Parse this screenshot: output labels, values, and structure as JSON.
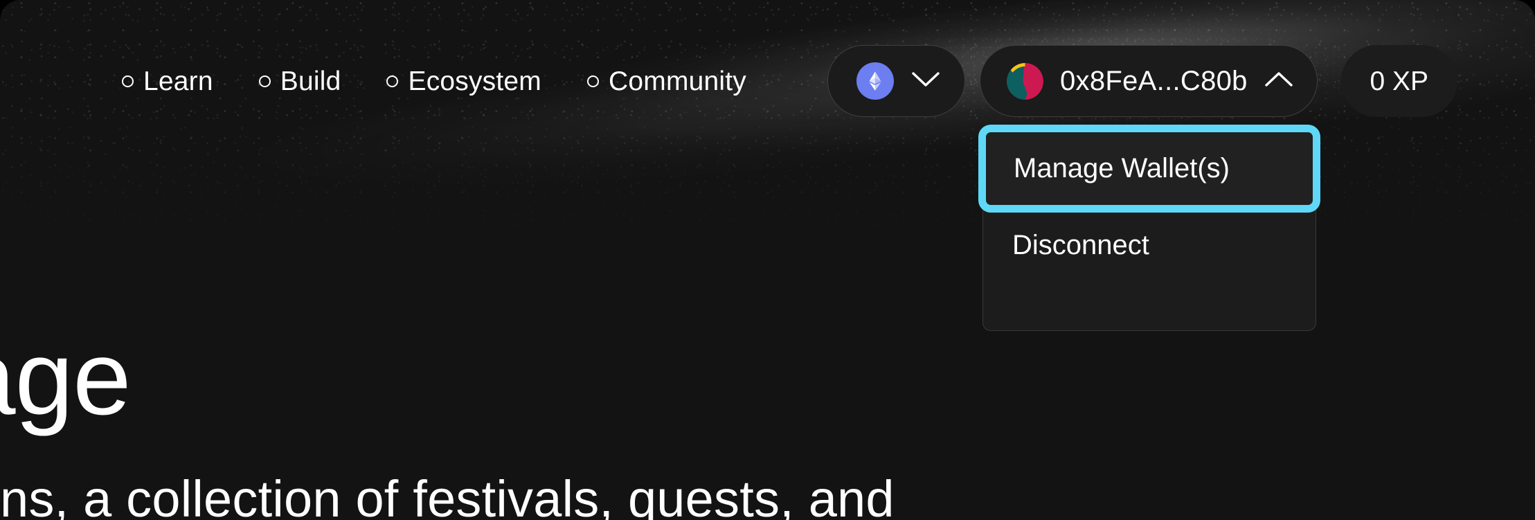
{
  "window": {
    "background_color": "#121212",
    "corner_radius_px": 30
  },
  "header": {
    "nav_items": [
      {
        "label": "Learn",
        "icon": "circle-ring-icon"
      },
      {
        "label": "Build",
        "icon": "circle-ring-icon"
      },
      {
        "label": "Ecosystem",
        "icon": "circle-ring-icon"
      },
      {
        "label": "Community",
        "icon": "circle-ring-icon"
      }
    ],
    "chain_selector": {
      "icon": "ethereum-icon",
      "icon_color": "#6c7ef0",
      "chevron": "chevron-down-icon"
    },
    "wallet_button": {
      "address": "0x8FeA...C80b",
      "avatar_icon": "wallet-avatar-icon",
      "avatar_colors": {
        "teal": "#0d5f60",
        "crimson": "#cd1951",
        "gold": "#f5c518"
      },
      "chevron": "chevron-up-icon",
      "expanded": true
    },
    "xp_badge": {
      "label": "0 XP"
    }
  },
  "wallet_menu": {
    "open": true,
    "focus_ring_color": "#5fd8f8",
    "items": [
      {
        "label": "Manage Wallet(s)",
        "focused": true
      },
      {
        "label": "Disconnect",
        "focused": false
      }
    ]
  },
  "hero": {
    "title_fragment": "age",
    "subtitle_fragment": "ions, a collection of festivals, quests, and"
  }
}
